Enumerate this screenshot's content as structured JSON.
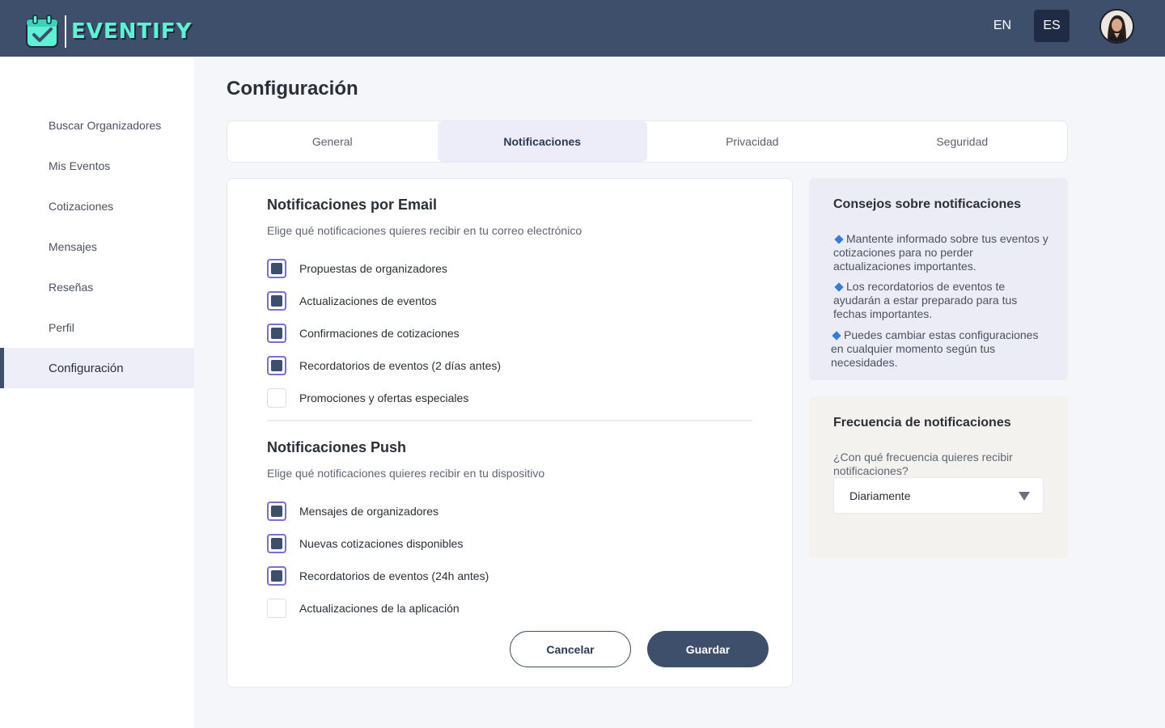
{
  "app": {
    "brand": "EVENTIFY"
  },
  "header": {
    "languages": [
      {
        "label": "EN",
        "active": false
      },
      {
        "label": "ES",
        "active": true
      }
    ]
  },
  "sidebar": {
    "items": [
      {
        "label": "Buscar Organizadores"
      },
      {
        "label": "Mis Eventos"
      },
      {
        "label": "Cotizaciones"
      },
      {
        "label": "Mensajes"
      },
      {
        "label": "Reseñas"
      },
      {
        "label": "Perfil"
      },
      {
        "label": "Configuración",
        "active": true
      }
    ]
  },
  "main": {
    "title": "Configuración",
    "tabs": [
      {
        "label": "General"
      },
      {
        "label": "Notificaciones",
        "active": true
      },
      {
        "label": "Privacidad"
      },
      {
        "label": "Seguridad"
      }
    ],
    "email": {
      "title": "Notificaciones por Email",
      "subtitle": "Elige qué notificaciones quieres recibir en tu correo electrónico",
      "options": [
        {
          "label": "Propuestas de organizadores",
          "checked": true
        },
        {
          "label": "Actualizaciones de eventos",
          "checked": true
        },
        {
          "label": "Confirmaciones de cotizaciones",
          "checked": true
        },
        {
          "label": "Recordatorios de eventos (2 días antes)",
          "checked": true
        },
        {
          "label": "Promociones y ofertas especiales",
          "checked": false
        }
      ]
    },
    "push": {
      "title": "Notificaciones Push",
      "subtitle": "Elige qué notificaciones quieres recibir en tu dispositivo",
      "options": [
        {
          "label": "Mensajes de organizadores",
          "checked": true
        },
        {
          "label": "Nuevas cotizaciones disponibles",
          "checked": true
        },
        {
          "label": "Recordatorios de eventos (24h antes)",
          "checked": true
        },
        {
          "label": "Actualizaciones de la aplicación",
          "checked": false
        }
      ]
    },
    "actions": {
      "cancel": "Cancelar",
      "save": "Guardar"
    }
  },
  "tips": {
    "title": "Consejos sobre notificaciones",
    "items": [
      "Mantente informado sobre tus eventos y cotizaciones para no perder actualizaciones importantes.",
      "Los recordatorios de eventos te ayudarán a estar preparado para tus fechas importantes.",
      "Puedes cambiar estas configuraciones en cualquier momento según tus necesidades."
    ]
  },
  "frequency": {
    "title": "Frecuencia de notificaciones",
    "question": "¿Con qué frecuencia quieres recibir notificaciones?",
    "selected": "Diariamente"
  },
  "colors": {
    "header": "#3d4f6b",
    "accent": "#3d4f6b",
    "brand_text": "#5ff0d8",
    "checkbox_border": "#7a6fd6"
  }
}
